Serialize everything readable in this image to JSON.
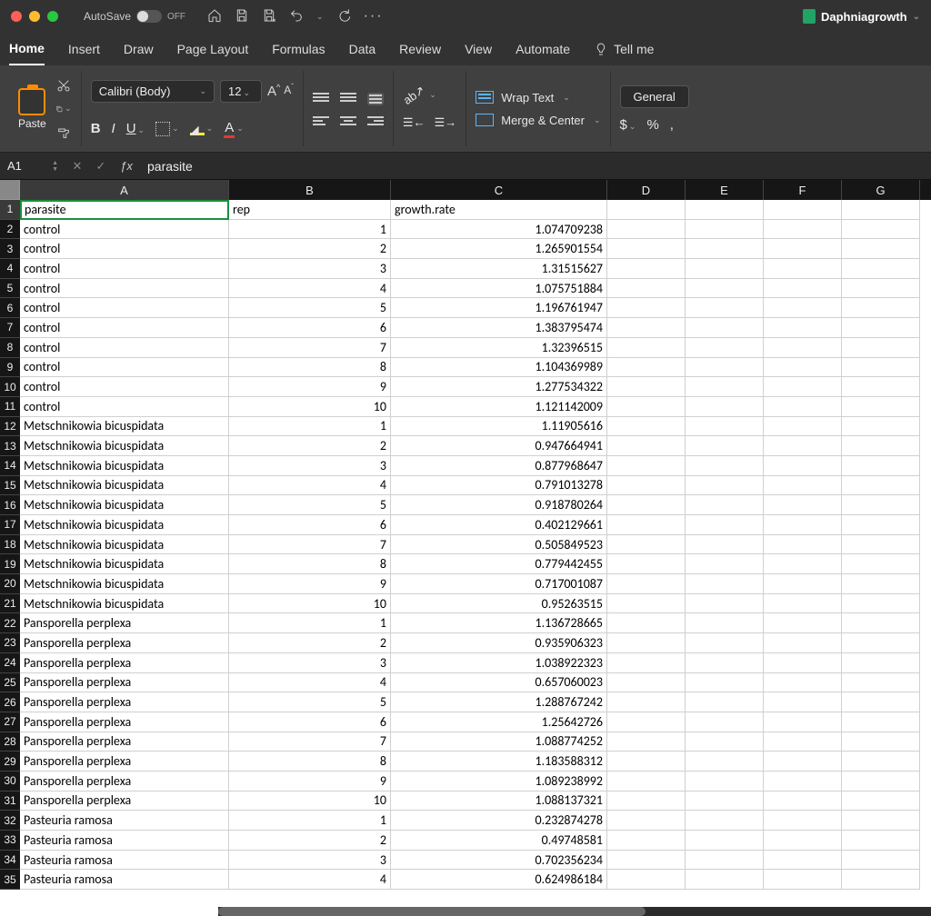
{
  "titleBar": {
    "autosaveLabel": "AutoSave",
    "autosaveState": "OFF",
    "docName": "Daphniagrowth"
  },
  "tabs": [
    "Home",
    "Insert",
    "Draw",
    "Page Layout",
    "Formulas",
    "Data",
    "Review",
    "View",
    "Automate"
  ],
  "tabsActive": "Home",
  "tellMe": "Tell me",
  "ribbon": {
    "pasteLabel": "Paste",
    "fontName": "Calibri (Body)",
    "fontSize": "12",
    "wrapText": "Wrap Text",
    "mergeCenter": "Merge & Center",
    "numberFormat": "General"
  },
  "formulaBar": {
    "nameBox": "A1",
    "formula": "parasite"
  },
  "columns": [
    "A",
    "B",
    "C",
    "D",
    "E",
    "F",
    "G"
  ],
  "headerRow": [
    "parasite",
    "rep",
    "growth.rate"
  ],
  "rows": [
    {
      "n": 2,
      "a": "control",
      "b": "1",
      "c": "1.074709238"
    },
    {
      "n": 3,
      "a": "control",
      "b": "2",
      "c": "1.265901554"
    },
    {
      "n": 4,
      "a": "control",
      "b": "3",
      "c": "1.31515627"
    },
    {
      "n": 5,
      "a": "control",
      "b": "4",
      "c": "1.075751884"
    },
    {
      "n": 6,
      "a": "control",
      "b": "5",
      "c": "1.196761947"
    },
    {
      "n": 7,
      "a": "control",
      "b": "6",
      "c": "1.383795474"
    },
    {
      "n": 8,
      "a": "control",
      "b": "7",
      "c": "1.32396515"
    },
    {
      "n": 9,
      "a": "control",
      "b": "8",
      "c": "1.104369989"
    },
    {
      "n": 10,
      "a": "control",
      "b": "9",
      "c": "1.277534322"
    },
    {
      "n": 11,
      "a": "control",
      "b": "10",
      "c": "1.121142009"
    },
    {
      "n": 12,
      "a": "Metschnikowia bicuspidata",
      "b": "1",
      "c": "1.11905616"
    },
    {
      "n": 13,
      "a": "Metschnikowia bicuspidata",
      "b": "2",
      "c": "0.947664941"
    },
    {
      "n": 14,
      "a": "Metschnikowia bicuspidata",
      "b": "3",
      "c": "0.877968647"
    },
    {
      "n": 15,
      "a": "Metschnikowia bicuspidata",
      "b": "4",
      "c": "0.791013278"
    },
    {
      "n": 16,
      "a": "Metschnikowia bicuspidata",
      "b": "5",
      "c": "0.918780264"
    },
    {
      "n": 17,
      "a": "Metschnikowia bicuspidata",
      "b": "6",
      "c": "0.402129661"
    },
    {
      "n": 18,
      "a": "Metschnikowia bicuspidata",
      "b": "7",
      "c": "0.505849523"
    },
    {
      "n": 19,
      "a": "Metschnikowia bicuspidata",
      "b": "8",
      "c": "0.779442455"
    },
    {
      "n": 20,
      "a": "Metschnikowia bicuspidata",
      "b": "9",
      "c": "0.717001087"
    },
    {
      "n": 21,
      "a": "Metschnikowia bicuspidata",
      "b": "10",
      "c": "0.95263515"
    },
    {
      "n": 22,
      "a": "Pansporella perplexa",
      "b": "1",
      "c": "1.136728665"
    },
    {
      "n": 23,
      "a": "Pansporella perplexa",
      "b": "2",
      "c": "0.935906323"
    },
    {
      "n": 24,
      "a": "Pansporella perplexa",
      "b": "3",
      "c": "1.038922323"
    },
    {
      "n": 25,
      "a": "Pansporella perplexa",
      "b": "4",
      "c": "0.657060023"
    },
    {
      "n": 26,
      "a": "Pansporella perplexa",
      "b": "5",
      "c": "1.288767242"
    },
    {
      "n": 27,
      "a": "Pansporella perplexa",
      "b": "6",
      "c": "1.25642726"
    },
    {
      "n": 28,
      "a": "Pansporella perplexa",
      "b": "7",
      "c": "1.088774252"
    },
    {
      "n": 29,
      "a": "Pansporella perplexa",
      "b": "8",
      "c": "1.183588312"
    },
    {
      "n": 30,
      "a": "Pansporella perplexa",
      "b": "9",
      "c": "1.089238992"
    },
    {
      "n": 31,
      "a": "Pansporella perplexa",
      "b": "10",
      "c": "1.088137321"
    },
    {
      "n": 32,
      "a": "Pasteuria ramosa",
      "b": "1",
      "c": "0.232874278"
    },
    {
      "n": 33,
      "a": "Pasteuria ramosa",
      "b": "2",
      "c": "0.49748581"
    },
    {
      "n": 34,
      "a": "Pasteuria ramosa",
      "b": "3",
      "c": "0.702356234"
    },
    {
      "n": 35,
      "a": "Pasteuria ramosa",
      "b": "4",
      "c": "0.624986184"
    }
  ]
}
